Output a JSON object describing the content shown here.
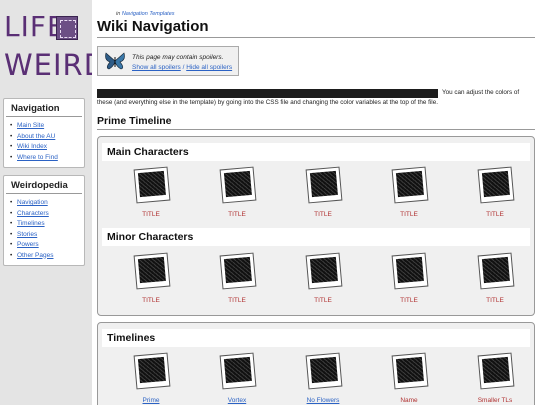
{
  "logo": {
    "line1": "LIFE",
    "line2": "WEIRD"
  },
  "navigation": {
    "title": "Navigation",
    "items": [
      "Main Site",
      "About the AU",
      "Wiki Index",
      "Where to Find"
    ]
  },
  "weirdopedia": {
    "title": "Weirdopedia",
    "items": [
      "Navigation",
      "Characters",
      "Timelines",
      "Stories",
      "Powers",
      "Other Pages"
    ]
  },
  "breadcrumb": {
    "prefix": "in",
    "link1": "Navigation",
    "link2": "Templates"
  },
  "page_title": "Wiki Navigation",
  "spoiler": {
    "notice": "This page may contain spoilers.",
    "show": "Show all spoilers",
    "separator": "/",
    "hide": "Hide all spoilers"
  },
  "info": {
    "line1_end": "You can adjust the colors of",
    "line2": "these (and everything else in the template) by going into the CSS file and changing the color variables at the top of the file."
  },
  "section_title": "Prime Timeline",
  "main_characters": {
    "title": "Main Characters",
    "labels": [
      "TITLE",
      "TITLE",
      "TITLE",
      "TITLE",
      "TITLE"
    ]
  },
  "minor_characters": {
    "title": "Minor Characters",
    "labels": [
      "TITLE",
      "TITLE",
      "TITLE",
      "TITLE",
      "TITLE"
    ]
  },
  "timelines": {
    "title": "Timelines",
    "labels": [
      "Prime",
      "Vortex",
      "No Flowers",
      "Name",
      "Smaller TLs"
    ]
  }
}
